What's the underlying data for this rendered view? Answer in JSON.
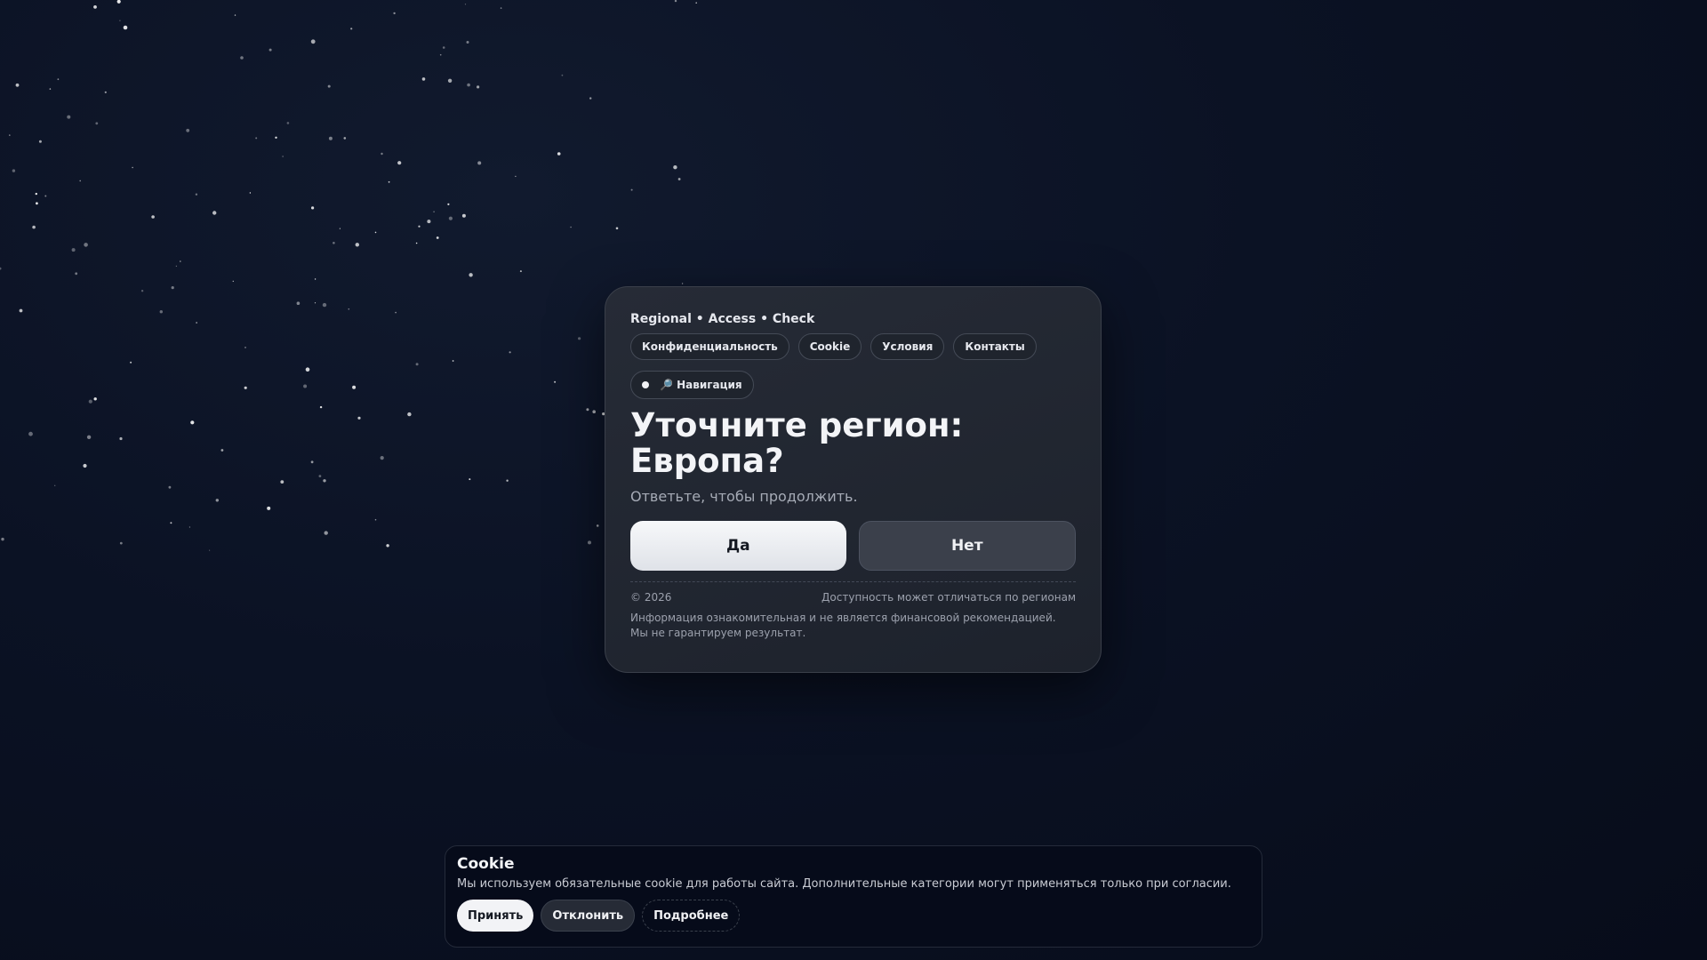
{
  "brand": "Regional • Access • Check",
  "nav": {
    "items": [
      "Конфиденциальность",
      "Cookie",
      "Условия",
      "Контакты"
    ]
  },
  "badge": {
    "icon": "magnifier-icon",
    "label": "🔎 Навигация"
  },
  "main": {
    "title": "Уточните регион: Европа?",
    "subtitle": "Ответьте, чтобы продолжить.",
    "yes_label": "Да",
    "no_label": "Нет"
  },
  "footer": {
    "copyright": "© 2026",
    "availability": "Доступность может отличаться по регионам",
    "disclaimer": "Информация ознакомительная и не является финансовой рекомендацией. Мы не гарантируем результат."
  },
  "cookie": {
    "title": "Cookie",
    "text": "Мы используем обязательные cookie для работы сайта. Дополнительные категории могут применяться только при согласии.",
    "accept_label": "Принять",
    "decline_label": "Отклонить",
    "more_label": "Подробнее"
  },
  "colors": {
    "background": "#0b1224",
    "card": "#232833",
    "primary_button": "#eef0f3",
    "secondary_button": "#3b404b"
  }
}
